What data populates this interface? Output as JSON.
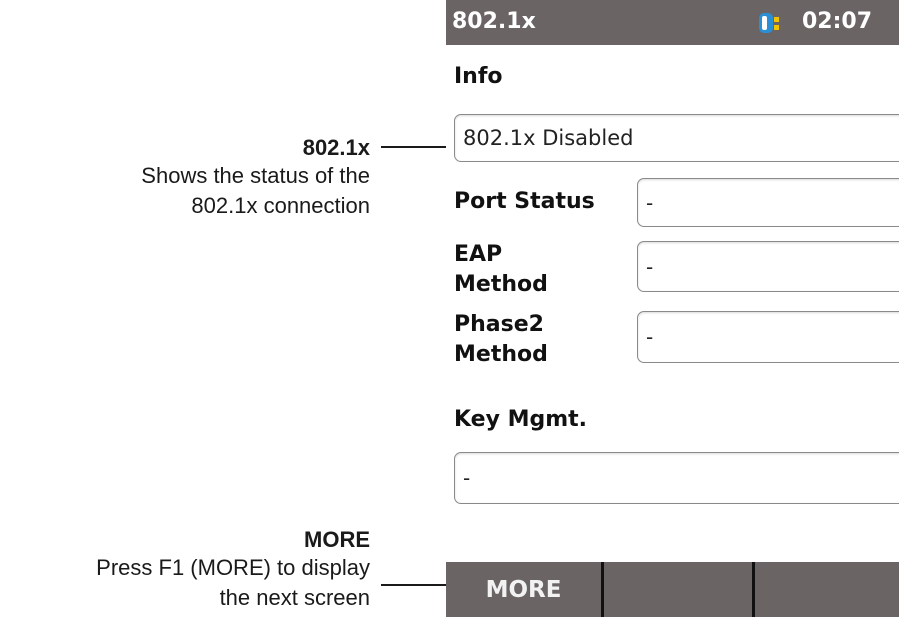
{
  "callouts": {
    "status": {
      "title": "802.1x",
      "line1": "Shows the status of the",
      "line2": "802.1x connection"
    },
    "more": {
      "title": "MORE",
      "line1": "Press F1 (MORE) to display",
      "line2": "the next screen"
    }
  },
  "device": {
    "title": "802.1x",
    "battery_icon": "battery-icon",
    "time": "02:07",
    "info_label": "Info",
    "info_value": "802.1x Disabled",
    "port_status_label": "Port Status",
    "port_status_value": "-",
    "eap_method_label_1": "EAP",
    "eap_method_label_2": "Method",
    "eap_method_value": "-",
    "phase2_method_label_1": "Phase2",
    "phase2_method_label_2": "Method",
    "phase2_method_value": "-",
    "key_mgmt_label": "Key Mgmt.",
    "key_mgmt_value": "-",
    "softkeys": [
      "MORE",
      "",
      ""
    ]
  },
  "colors": {
    "bar": "#6b6464",
    "battery_blue": "#2b8fd6",
    "battery_yellow": "#f2c400"
  }
}
